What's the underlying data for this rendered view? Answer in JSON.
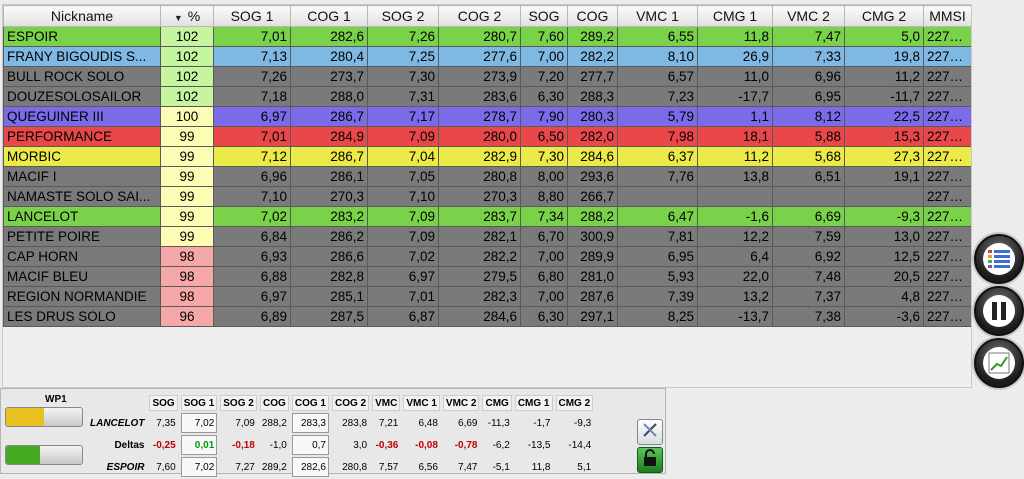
{
  "table": {
    "columns": [
      "Nickname",
      "%",
      "SOG 1",
      "COG 1",
      "SOG 2",
      "COG 2",
      "SOG",
      "COG",
      "VMC 1",
      "CMG 1",
      "VMC 2",
      "CMG 2",
      "MMSI"
    ],
    "rows": [
      {
        "color": "#7ad24a",
        "pct_color": "#c6f5a0",
        "cells": [
          "ESPOIR",
          "102",
          "7,01",
          "282,6",
          "7,26",
          "280,7",
          "7,60",
          "289,2",
          "6,55",
          "11,8",
          "7,47",
          "5,0",
          "2279..."
        ]
      },
      {
        "color": "#7fb8e2",
        "pct_color": "#c6f5a0",
        "cells": [
          "FRANY BIGOUDIS S...",
          "102",
          "7,13",
          "280,4",
          "7,25",
          "277,6",
          "7,00",
          "282,2",
          "8,10",
          "26,9",
          "7,33",
          "19,8",
          "2279..."
        ]
      },
      {
        "color": "#7a7a7a",
        "pct_color": "#c6f5a0",
        "cells": [
          "BULL ROCK SOLO",
          "102",
          "7,26",
          "273,7",
          "7,30",
          "273,9",
          "7,20",
          "277,7",
          "6,57",
          "11,0",
          "6,96",
          "11,2",
          "2279..."
        ]
      },
      {
        "color": "#7a7a7a",
        "pct_color": "#c6f5a0",
        "cells": [
          "DOUZESOLOSAILOR",
          "102",
          "7,18",
          "288,0",
          "7,31",
          "283,6",
          "6,30",
          "288,3",
          "7,23",
          "-17,7",
          "6,95",
          "-11,7",
          "2279..."
        ]
      },
      {
        "color": "#7a6ce8",
        "pct_color": "#fcfcb4",
        "cells": [
          "QUEGUINER III",
          "100",
          "6,97",
          "286,7",
          "7,17",
          "278,7",
          "7,90",
          "280,3",
          "5,79",
          "1,1",
          "8,12",
          "22,5",
          "2279..."
        ]
      },
      {
        "color": "#e8484a",
        "pct_color": "#fcfcb4",
        "cells": [
          "PERFORMANCE",
          "99",
          "7,01",
          "284,9",
          "7,09",
          "280,0",
          "6,50",
          "282,0",
          "7,98",
          "18,1",
          "5,88",
          "15,3",
          "2279..."
        ]
      },
      {
        "color": "#ecea48",
        "pct_color": "#fcfcb4",
        "cells": [
          "MORBIC",
          "99",
          "7,12",
          "286,7",
          "7,04",
          "282,9",
          "7,30",
          "284,6",
          "6,37",
          "11,2",
          "5,68",
          "27,3",
          "2279..."
        ]
      },
      {
        "color": "#7a7a7a",
        "pct_color": "#fcfcb4",
        "cells": [
          "MACIF I",
          "99",
          "6,96",
          "286,1",
          "7,05",
          "280,8",
          "8,00",
          "293,6",
          "7,76",
          "13,8",
          "6,51",
          "19,1",
          "2279..."
        ]
      },
      {
        "color": "#7a7a7a",
        "pct_color": "#fcfcb4",
        "cells": [
          "NAMASTE SOLO SAI...",
          "99",
          "7,10",
          "270,3",
          "7,10",
          "270,3",
          "8,80",
          "266,7",
          "",
          "",
          "",
          "",
          "2279..."
        ]
      },
      {
        "color": "#7ad24a",
        "pct_color": "#fcfcb4",
        "cells": [
          "LANCELOT",
          "99",
          "7,02",
          "283,2",
          "7,09",
          "283,7",
          "7,34",
          "288,2",
          "6,47",
          "-1,6",
          "6,69",
          "-9,3",
          "2279..."
        ]
      },
      {
        "color": "#7a7a7a",
        "pct_color": "#fcfcb4",
        "cells": [
          "PETITE POIRE",
          "99",
          "6,84",
          "286,2",
          "7,09",
          "282,1",
          "6,70",
          "300,9",
          "7,81",
          "12,2",
          "7,59",
          "13,0",
          "2279..."
        ]
      },
      {
        "color": "#7a7a7a",
        "pct_color": "#f6a8a8",
        "cells": [
          "CAP HORN",
          "98",
          "6,93",
          "286,6",
          "7,02",
          "282,2",
          "7,00",
          "289,9",
          "6,95",
          "6,4",
          "6,92",
          "12,5",
          "2279..."
        ]
      },
      {
        "color": "#7a7a7a",
        "pct_color": "#f6a8a8",
        "cells": [
          "MACIF BLEU",
          "98",
          "6,88",
          "282,8",
          "6,97",
          "279,5",
          "6,80",
          "281,0",
          "5,93",
          "22,0",
          "7,48",
          "20,5",
          "2279..."
        ]
      },
      {
        "color": "#7a7a7a",
        "pct_color": "#f6a8a8",
        "cells": [
          "REGION NORMANDIE",
          "98",
          "6,97",
          "285,1",
          "7,01",
          "282,3",
          "7,00",
          "287,6",
          "7,39",
          "13,2",
          "7,37",
          "4,8",
          "2279..."
        ]
      },
      {
        "color": "#7a7a7a",
        "pct_color": "#f6a8a8",
        "cells": [
          "LES DRUS SOLO",
          "96",
          "6,89",
          "287,5",
          "6,87",
          "284,6",
          "6,30",
          "297,1",
          "8,25",
          "-13,7",
          "7,38",
          "-3,6",
          "2279..."
        ]
      }
    ]
  },
  "sidebar": {
    "icons": [
      "list-icon",
      "pause-icon",
      "chart-icon"
    ]
  },
  "comparison": {
    "wp_label": "WP1",
    "headers": [
      "SOG",
      "SOG 1",
      "SOG 2",
      "COG",
      "COG 1",
      "COG 2",
      "VMC",
      "VMC 1",
      "VMC 2",
      "CMG",
      "CMG 1",
      "CMG 2"
    ],
    "rows": [
      {
        "label": "LANCELOT",
        "values": [
          "7,35",
          "7,02",
          "7,09",
          "288,2",
          "283,3",
          "283,8",
          "7,21",
          "6,48",
          "6,69",
          "-11,3",
          "-1,7",
          "-9,3"
        ],
        "boxed": [
          1,
          4
        ],
        "classes": []
      },
      {
        "label": "Deltas",
        "values": [
          "-0,25",
          "0,01",
          "-0,18",
          "-1,0",
          "0,7",
          "3,0",
          "-0,36",
          "-0,08",
          "-0,78",
          "-6,2",
          "-13,5",
          "-14,4"
        ],
        "boxed": [
          1,
          4
        ],
        "classes": [
          "neg",
          "pos",
          "neg",
          "",
          "",
          "",
          "neg",
          "neg",
          "neg",
          "",
          "",
          ""
        ]
      },
      {
        "label": "ESPOIR",
        "values": [
          "7,60",
          "7,02",
          "7,27",
          "289,2",
          "282,6",
          "280,8",
          "7,57",
          "6,56",
          "7,47",
          "-5,1",
          "11,8",
          "5,1"
        ],
        "boxed": [
          1,
          4
        ],
        "classes": []
      }
    ],
    "progress_top": {
      "color": "#e8c020",
      "fraction": 0.5
    },
    "progress_bottom": {
      "color": "#44aa22",
      "fraction": 0.45
    }
  }
}
